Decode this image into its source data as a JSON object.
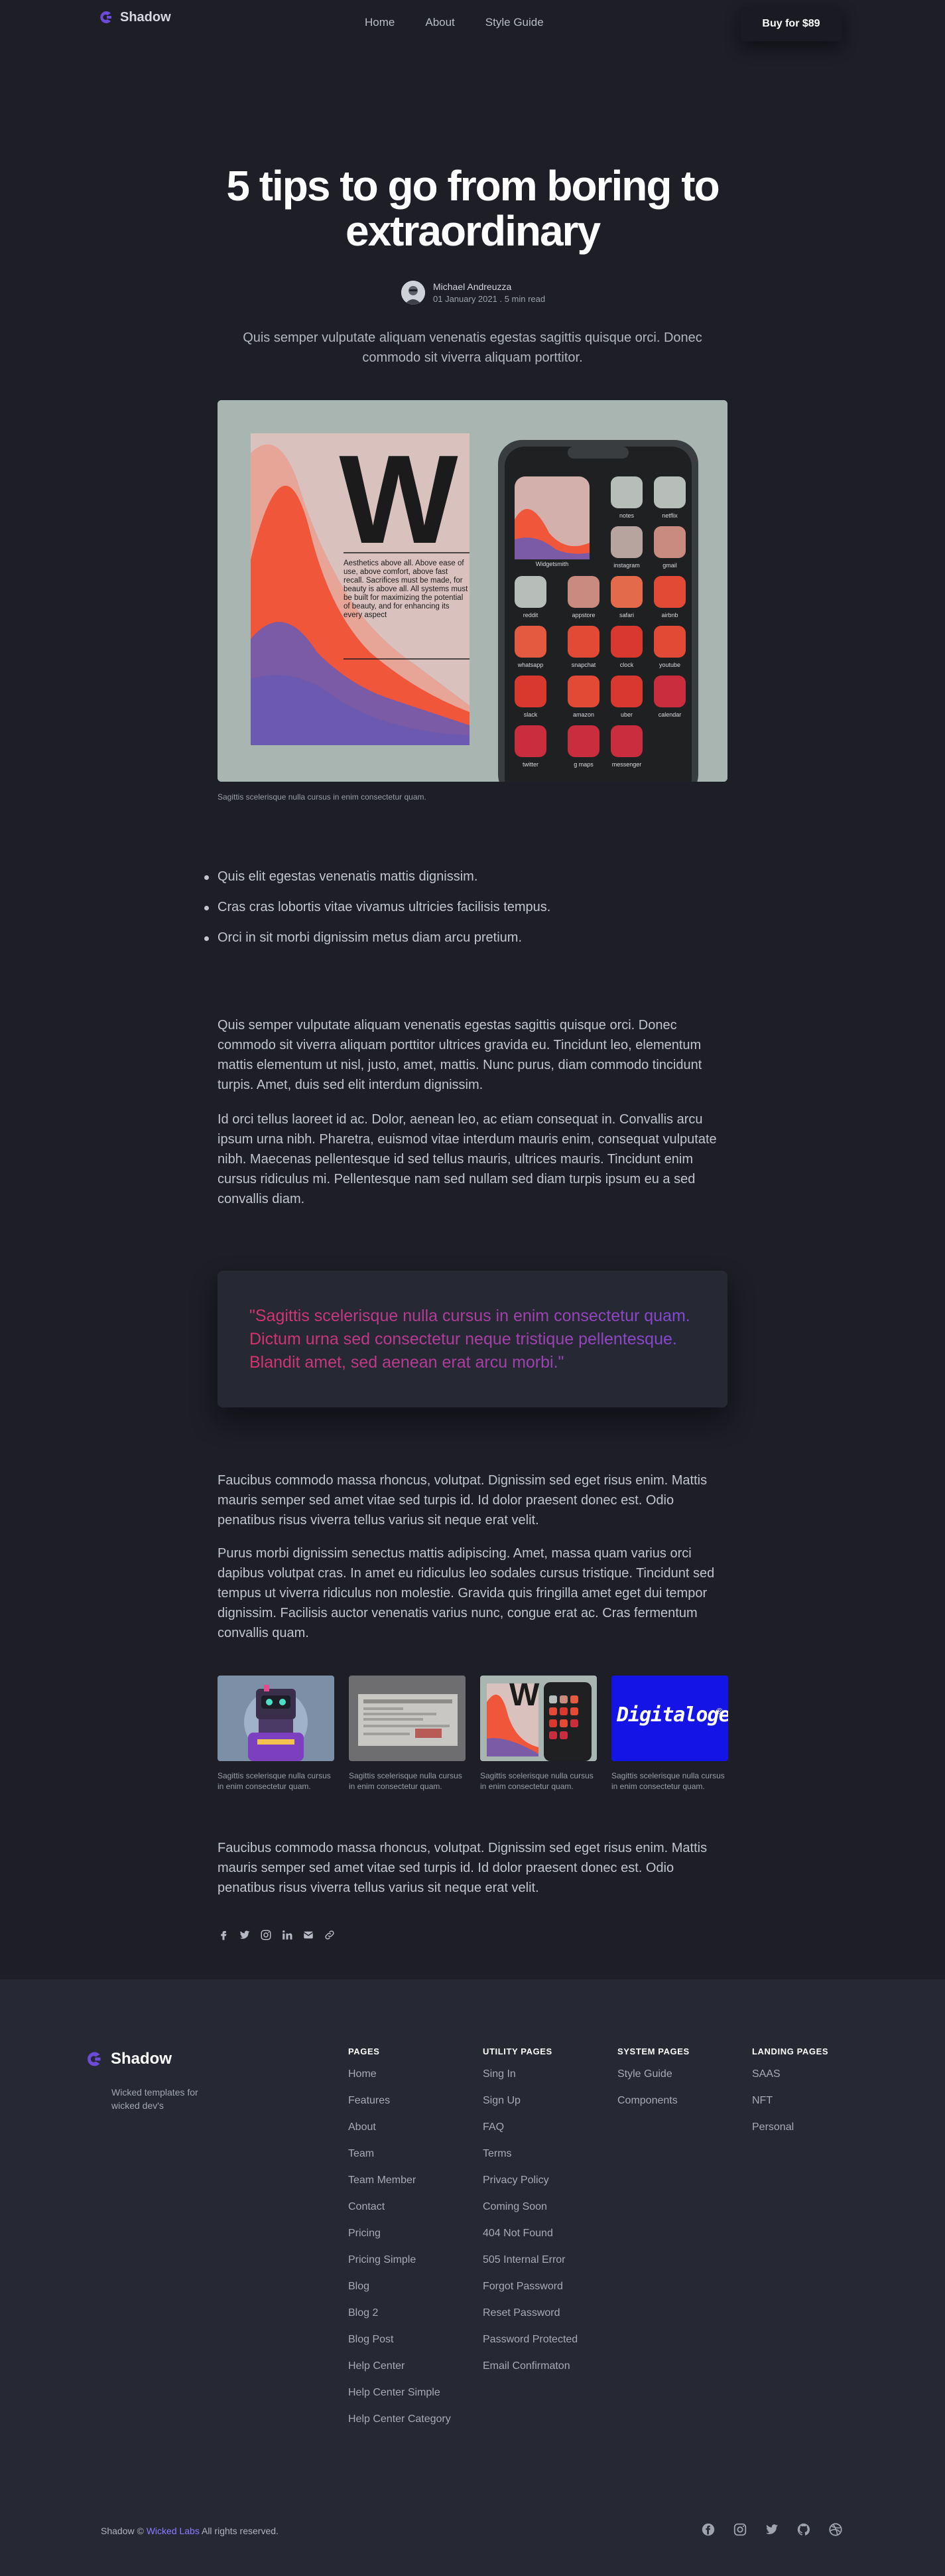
{
  "header": {
    "brand": "Shadow",
    "nav": [
      "Home",
      "About",
      "Style Guide"
    ],
    "buy_label": "Buy for $89"
  },
  "article": {
    "title": "5 tips to go from boring to extraordinary",
    "author_name": "Michael Andreuzza",
    "author_meta": "01 January 2021 . 5 min read",
    "lead": "Quis semper vulputate aliquam venenatis egestas sagittis quisque orci. Donec commodo sit viverra aliquam porttitor.",
    "hero_caption": "Sagittis scelerisque nulla cursus in enim consectetur quam.",
    "hero_poster_letter": "W",
    "hero_poster_text": "Aesthetics above all. Above ease of use, above comfort, above fast recall. Sacrifices must be made, for beauty is above all. All systems must be built for maximizing the potential of beauty, and for enhancing its every aspect",
    "phone_apps": [
      [
        "notes",
        "netflix"
      ],
      [
        "Widgetsmith",
        "instagram",
        "gmail"
      ],
      [
        "reddit",
        "appstore",
        "safari",
        "airbnb"
      ],
      [
        "whatsapp",
        "snapchat",
        "clock",
        "youtube"
      ],
      [
        "slack",
        "amazon",
        "uber",
        "calendar"
      ],
      [
        "twitter",
        "g maps",
        "messenger"
      ]
    ],
    "bullets": [
      "Quis elit egestas venenatis mattis dignissim.",
      "Cras cras lobortis vitae vivamus ultricies facilisis tempus.",
      "Orci in sit morbi dignissim metus diam arcu pretium."
    ],
    "para1": "Quis semper vulputate aliquam venenatis egestas sagittis quisque orci. Donec commodo sit viverra aliquam porttitor ultrices gravida eu. Tincidunt leo, elementum mattis elementum ut nisl, justo, amet, mattis. Nunc purus, diam commodo tincidunt turpis. Amet, duis sed elit interdum dignissim.",
    "para2": "Id orci tellus laoreet id ac. Dolor, aenean leo, ac etiam consequat in. Convallis arcu ipsum urna nibh. Pharetra, euismod vitae interdum mauris enim, consequat vulputate nibh. Maecenas pellentesque id sed tellus mauris, ultrices mauris. Tincidunt enim cursus ridiculus mi. Pellentesque nam sed nullam sed diam turpis ipsum eu a sed convallis diam.",
    "quote": "\"Sagittis scelerisque nulla cursus in enim consectetur quam. Dictum urna sed consectetur neque tristique pellentesque. Blandit amet, sed aenean erat arcu morbi.\"",
    "para3": "Faucibus commodo massa rhoncus, volutpat. Dignissim sed eget risus enim. Mattis mauris semper sed amet vitae sed turpis id. Id dolor praesent donec est. Odio penatibus risus viverra tellus varius sit neque erat velit.",
    "para4": "Purus morbi dignissim senectus mattis adipiscing. Amet, massa quam varius orci dapibus volutpat cras. In amet eu ridiculus leo sodales cursus tristique. Tincidunt sed tempus ut viverra ridiculus non molestie. Gravida quis fringilla amet eget dui tempor dignissim. Facilisis auctor venenatis varius nunc, congue erat ac. Cras fermentum convallis quam.",
    "gallery_captions": [
      "Sagittis scelerisque nulla cursus in enim consectetur quam.",
      "Sagittis scelerisque nulla cursus in enim consectetur quam.",
      "Sagittis scelerisque nulla cursus in enim consectetur quam.",
      "Sagittis scelerisque nulla cursus in enim consectetur quam."
    ],
    "gallery_logo_text": "Digitaloge",
    "para5": "Faucibus commodo massa rhoncus, volutpat. Dignissim sed eget risus enim. Mattis mauris semper sed amet vitae sed turpis id. Id dolor praesent donec est. Odio penatibus risus viverra tellus varius sit neque erat velit.",
    "share_icons": [
      "facebook-icon",
      "twitter-icon",
      "instagram-icon",
      "linkedin-icon",
      "mail-icon",
      "link-icon"
    ]
  },
  "footer": {
    "brand": "Shadow",
    "tagline": "Wicked templates for wicked dev's",
    "columns": [
      {
        "heading": "PAGES",
        "links": [
          "Home",
          "Features",
          "About",
          "Team",
          "Team Member",
          "Contact",
          "Pricing",
          "Pricing Simple",
          "Blog",
          "Blog 2",
          "Blog Post",
          "Help Center",
          "Help Center Simple",
          "Help Center Category"
        ]
      },
      {
        "heading": "UTILITY PAGES",
        "links": [
          "Sing In",
          "Sign Up",
          "FAQ",
          "Terms",
          "Privacy Policy",
          "Coming Soon",
          "404 Not Found",
          "505 Internal Error",
          "Forgot Password",
          "Reset Password",
          "Password Protected",
          "Email Confirmaton"
        ]
      },
      {
        "heading": "SYSTEM PAGES",
        "links": [
          "Style Guide",
          "Components"
        ]
      },
      {
        "heading": "LANDING PAGES",
        "links": [
          "SAAS",
          "NFT",
          "Personal"
        ]
      }
    ],
    "copyright_prefix": "Shadow ©",
    "copyright_link": "Wicked Labs",
    "copyright_suffix": "All rights reserved.",
    "social_icons": [
      "facebook-icon",
      "instagram-icon",
      "twitter-icon",
      "github-icon",
      "dribbble-icon"
    ]
  },
  "colors": {
    "background": "#1d1e26",
    "footer_background": "#262834",
    "accent": "#8b7bff",
    "brand_mark": "#6c4bd8"
  }
}
